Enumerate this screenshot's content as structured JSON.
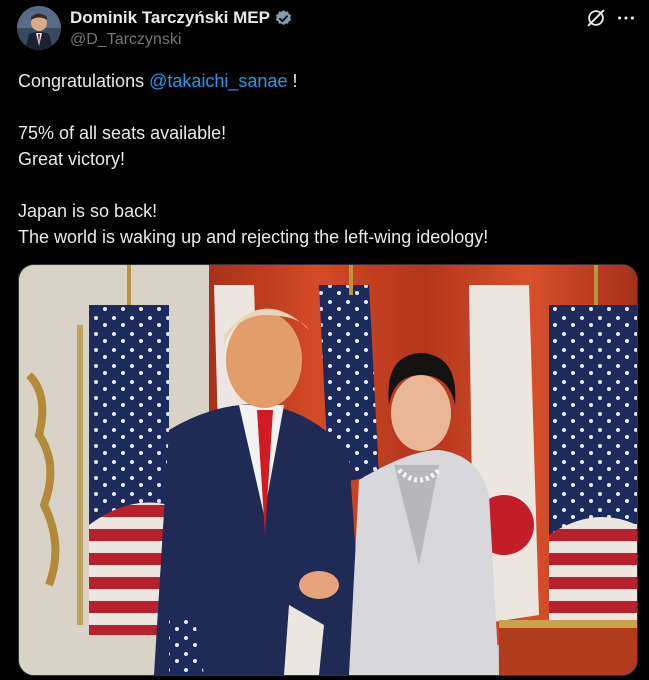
{
  "author": {
    "display_name": "Dominik Tarczyński MEP",
    "handle": "@D_Tarczynski",
    "verified": true
  },
  "tweet": {
    "line1_prefix": "Congratulations ",
    "mention": "@takaichi_sanae",
    "line1_suffix": " !",
    "line3": "75% of all seats available!",
    "line4": "Great victory!",
    "line6": "Japan is so back!",
    "line7": "The world is waking up and rejecting the left-wing ideology!"
  },
  "media": {
    "description_icon": "photo"
  },
  "colors": {
    "background": "#000000",
    "text": "#e7e9ea",
    "secondary": "#71767b",
    "link": "#1d9bf0",
    "verified": "#829aab"
  },
  "icons": {
    "verified": "verified-badge-icon",
    "grok": "grok-icon",
    "more": "more-dots-icon"
  }
}
